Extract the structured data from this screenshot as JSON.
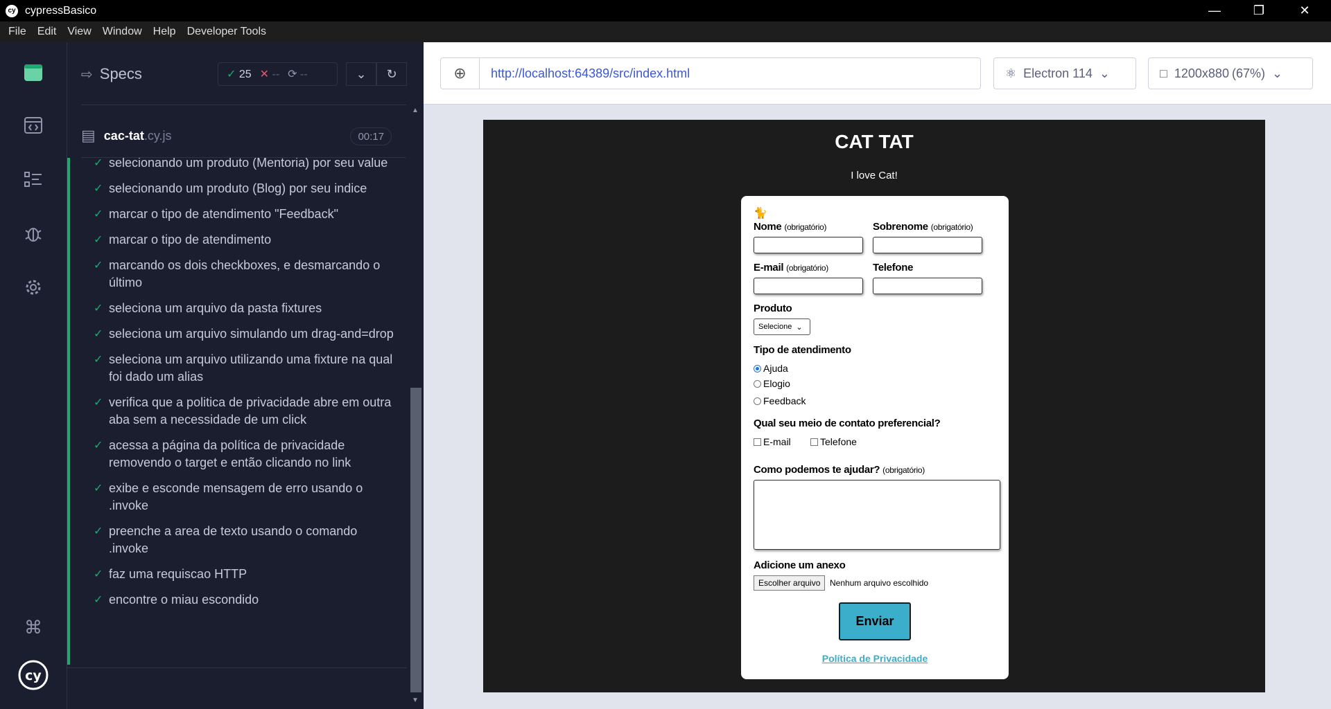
{
  "window": {
    "title": "cypressBasico",
    "logo": "cy"
  },
  "menu": [
    "File",
    "Edit",
    "View",
    "Window",
    "Help",
    "Developer Tools"
  ],
  "specs": {
    "title": "Specs",
    "passed": "25",
    "failed": "--",
    "pending": "--",
    "file_name": "cac-tat",
    "file_ext": ".cy.js",
    "duration": "00:17",
    "tests": [
      "selecionando um produto (Mentoria) por seu value",
      "selecionando um produto (Blog) por seu indice",
      "marcar o tipo de atendimento \"Feedback\"",
      "marcar o tipo de atendimento",
      "marcando os dois checkboxes, e desmarcando o último",
      "seleciona um arquivo da pasta fixtures",
      "seleciona um arquivo simulando um drag-and=drop",
      "seleciona um arquivo utilizando uma fixture na qual foi dado um alias",
      "verifica que a politica de privacidade abre em outra aba sem a necessidade de um click",
      "acessa a página da política de privacidade removendo o target e então clicando no link",
      "exibe e esconde mensagem de erro usando o .invoke",
      "preenche a area de texto usando o comando .invoke",
      "faz uma requiscao HTTP",
      "encontre o miau escondido"
    ]
  },
  "toolbar": {
    "url": "http://localhost:64389/src/index.html",
    "browser": "Electron 114",
    "viewport": "1200x880",
    "zoom": "(67%)"
  },
  "app": {
    "title": "CAT TAT",
    "subtitle": "I love Cat!",
    "cat_emoji": "🐈",
    "first_name_label": "Nome",
    "last_name_label": "Sobrenome",
    "email_label": "E-mail",
    "phone_label": "Telefone",
    "required": "(obrigatório)",
    "product_label": "Produto",
    "product_selected": "Selecione",
    "service_label": "Tipo de atendimento",
    "service_options": [
      "Ajuda",
      "Elogio",
      "Feedback"
    ],
    "contact_label": "Qual seu meio de contato preferencial?",
    "contact_email": "E-mail",
    "contact_phone": "Telefone",
    "help_label": "Como podemos te ajudar?",
    "attach_label": "Adicione um anexo",
    "file_button": "Escolher arquivo",
    "file_status": "Nenhum arquivo escolhido",
    "submit": "Enviar",
    "privacy": "Política de Privacidade"
  }
}
